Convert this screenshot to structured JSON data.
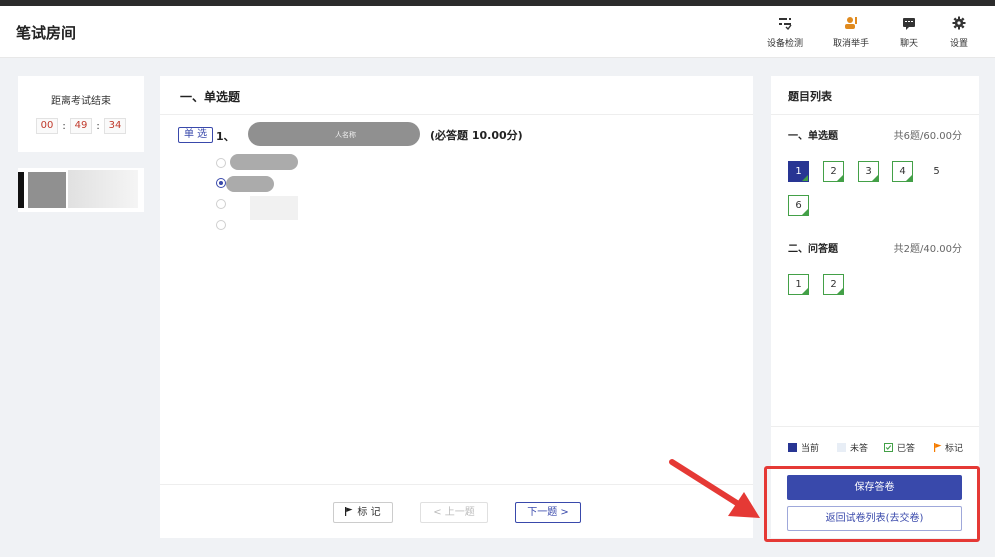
{
  "header": {
    "title": "笔试房间",
    "buttons": [
      {
        "label": "设备检测",
        "icon": "device-check-icon"
      },
      {
        "label": "取消举手",
        "icon": "raise-hand-icon"
      },
      {
        "label": "聊天",
        "icon": "chat-icon"
      },
      {
        "label": "设置",
        "icon": "gear-icon"
      }
    ]
  },
  "timer": {
    "label": "距离考试结束",
    "hours": "00",
    "minutes": "49",
    "seconds": "34",
    "sep": ":"
  },
  "question": {
    "section_title": "一、单选题",
    "type_tag": "单 选",
    "number": "1、",
    "blurred_text": "人名称",
    "meta": "(必答题 10.00分)",
    "selected_option_index": 1
  },
  "footer": {
    "mark_label": "标 记",
    "prev_label": "< 上一题",
    "next_label": "下一题 >"
  },
  "sidebar": {
    "title": "题目列表",
    "groups": [
      {
        "title": "一、单选题",
        "score": "共6题/60.00分",
        "items": [
          "1",
          "2",
          "3",
          "4",
          "5",
          "6"
        ]
      },
      {
        "title": "二、问答题",
        "score": "共2题/40.00分",
        "items": [
          "1",
          "2"
        ]
      }
    ],
    "legend": {
      "current": "当前",
      "unanswered": "未答",
      "answered": "已答",
      "marked": "标记"
    },
    "save_label": "保存答卷",
    "back_label": "返回试卷列表(去交卷)"
  },
  "colors": {
    "primary": "#3949ab",
    "current": "#283593",
    "answered": "#43a047",
    "mark": "#f57c00",
    "timer": "#c0392b",
    "annotation": "#e53935"
  }
}
